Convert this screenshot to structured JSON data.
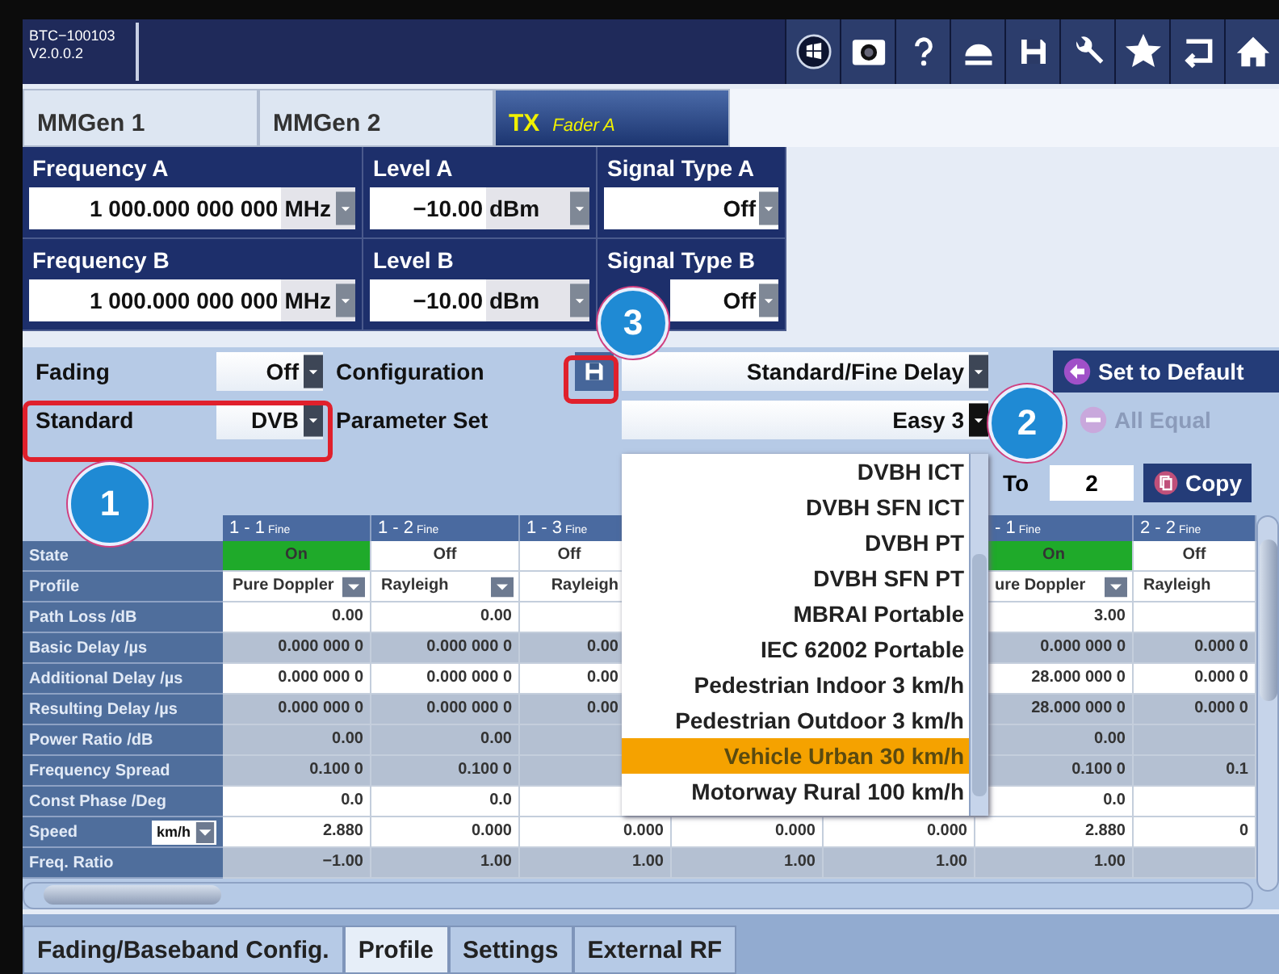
{
  "header": {
    "device": "BTC−100103",
    "version": "V2.0.0.2"
  },
  "tabs": [
    {
      "label": "MMGen 1",
      "selected": false
    },
    {
      "label": "MMGen 2",
      "selected": false
    },
    {
      "label": "TX",
      "sublabel": "Fader A",
      "selected": true
    }
  ],
  "signals": [
    {
      "label": "Frequency A",
      "value": "1 000.000 000 000",
      "unit": "MHz"
    },
    {
      "label": "Level A",
      "value": "−10.00",
      "unit": "dBm"
    },
    {
      "label": "Signal Type A",
      "value": "Off"
    },
    {
      "label": "Frequency B",
      "value": "1 000.000 000 000",
      "unit": "MHz"
    },
    {
      "label": "Level B",
      "value": "−10.00",
      "unit": "dBm"
    },
    {
      "label": "Signal Type B",
      "value": "Off"
    }
  ],
  "fading": {
    "label": "Fading",
    "value": "Off"
  },
  "configuration": {
    "label": "Configuration",
    "value": "Standard/Fine Delay"
  },
  "standard": {
    "label": "Standard",
    "value": "DVB"
  },
  "parameter_set": {
    "label": "Parameter Set",
    "value": "Easy 3",
    "expanded": true,
    "options": [
      {
        "label": "DVBH ICT",
        "selected": false
      },
      {
        "label": "DVBH SFN ICT",
        "selected": false
      },
      {
        "label": "DVBH PT",
        "selected": false
      },
      {
        "label": "DVBH SFN PT",
        "selected": false
      },
      {
        "label": "MBRAI Portable",
        "selected": false
      },
      {
        "label": "IEC 62002 Portable",
        "selected": false
      },
      {
        "label": "Pedestrian Indoor 3 km/h",
        "selected": false
      },
      {
        "label": "Pedestrian Outdoor 3 km/h",
        "selected": false
      },
      {
        "label": "Vehicle Urban 30 km/h",
        "selected": true
      },
      {
        "label": "Motorway Rural 100 km/h",
        "selected": false
      }
    ]
  },
  "buttons": [
    {
      "label": "Set to Default",
      "disabled": false
    },
    {
      "label": "All Equal",
      "disabled": true
    }
  ],
  "copy": {
    "label": "To",
    "value": "2",
    "button": "Copy"
  },
  "table": {
    "columns": [
      {
        "id": "1 - 1",
        "mode": "Fine"
      },
      {
        "id": "1 - 2",
        "mode": "Fine"
      },
      {
        "id": "1 - 3",
        "mode": "Fine"
      },
      null,
      null,
      {
        "id": "- 1",
        "mode": "Fine"
      },
      {
        "id": "2 - 2",
        "mode": "Fine"
      }
    ],
    "rows": [
      {
        "kind": "state",
        "label": "State",
        "cells": [
          {
            "text": "On",
            "on": true
          },
          {
            "text": "Off",
            "on": false
          },
          {
            "text": "Off",
            "on": false
          },
          null,
          null,
          {
            "text": "On",
            "on": true
          },
          {
            "text": "Off",
            "on": false
          }
        ]
      },
      {
        "kind": "profile",
        "label": "Profile",
        "cells": [
          {
            "text": "Pure Doppler",
            "arrow": true
          },
          {
            "text": "Rayleigh",
            "arrow": true
          },
          {
            "text": "Rayleigh",
            "arrow": false
          },
          null,
          null,
          {
            "text": "ure Doppler",
            "arrow": true
          },
          {
            "text": "Rayleigh",
            "arrow": false
          }
        ]
      },
      {
        "kind": "value",
        "label": "Path Loss /dB",
        "shaded": false,
        "cells": [
          "0.00",
          "0.00",
          null,
          null,
          null,
          "3.00",
          null
        ]
      },
      {
        "kind": "value",
        "label": "Basic Delay /µs",
        "shaded": true,
        "cells": [
          "0.000 000 0",
          "0.000 000 0",
          "0.00",
          null,
          null,
          "0.000 000 0",
          "0.000 0"
        ]
      },
      {
        "kind": "value",
        "label": "Additional Delay /µs",
        "shaded": false,
        "cells": [
          "0.000 000 0",
          "0.000 000 0",
          "0.00",
          null,
          null,
          "28.000 000 0",
          "0.000 0"
        ]
      },
      {
        "kind": "value",
        "label": "Resulting Delay /µs",
        "shaded": true,
        "cells": [
          "0.000 000 0",
          "0.000 000 0",
          "0.00",
          null,
          null,
          "28.000 000 0",
          "0.000 0"
        ]
      },
      {
        "kind": "value",
        "label": "Power Ratio /dB",
        "shaded": true,
        "cells": [
          "0.00",
          "0.00",
          null,
          null,
          null,
          "0.00",
          null
        ]
      },
      {
        "kind": "value",
        "label": "Frequency Spread",
        "shaded": true,
        "cells": [
          "0.100 0",
          "0.100 0",
          null,
          null,
          null,
          "0.100 0",
          "0.1"
        ]
      },
      {
        "kind": "value",
        "label": "Const Phase /Deg",
        "shaded": false,
        "cells": [
          "0.0",
          "0.0",
          null,
          null,
          null,
          "0.0",
          null
        ]
      },
      {
        "kind": "speed",
        "label": "Speed",
        "unit": "km/h",
        "shaded": false,
        "cells": [
          "2.880",
          "0.000",
          "0.000",
          "0.000",
          "0.000",
          "2.880",
          "0"
        ]
      },
      {
        "kind": "value",
        "label": "Freq. Ratio",
        "shaded": true,
        "cells": [
          "−1.00",
          "1.00",
          "1.00",
          "1.00",
          "1.00",
          "1.00",
          null
        ]
      }
    ]
  },
  "bottom_tabs": [
    {
      "label": "Fading/Baseband Config.",
      "selected": false
    },
    {
      "label": "Profile",
      "selected": true
    },
    {
      "label": "Settings",
      "selected": false
    },
    {
      "label": "External RF",
      "selected": false
    }
  ],
  "callouts": [
    {
      "label": "1"
    },
    {
      "label": "2"
    },
    {
      "label": "3"
    }
  ]
}
